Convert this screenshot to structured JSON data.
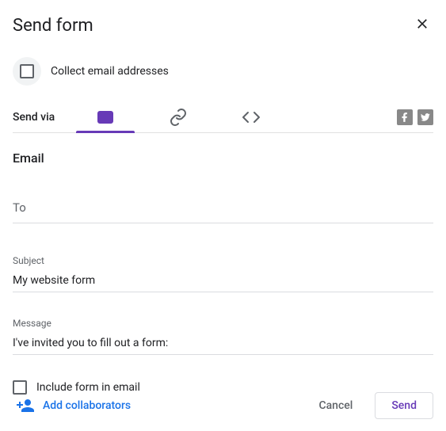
{
  "header": {
    "title": "Send form"
  },
  "collect": {
    "label": "Collect email addresses",
    "checked": false
  },
  "sendVia": {
    "label": "Send via"
  },
  "tabs": {
    "active": "email"
  },
  "emailSection": {
    "title": "Email",
    "to": {
      "placeholder": "To",
      "value": ""
    },
    "subject": {
      "label": "Subject",
      "value": "My website form"
    },
    "message": {
      "label": "Message",
      "value": "I've invited you to fill out a form:"
    },
    "includeForm": {
      "label": "Include form in email",
      "checked": false
    }
  },
  "footer": {
    "addCollaborators": "Add collaborators",
    "cancel": "Cancel",
    "send": "Send"
  }
}
